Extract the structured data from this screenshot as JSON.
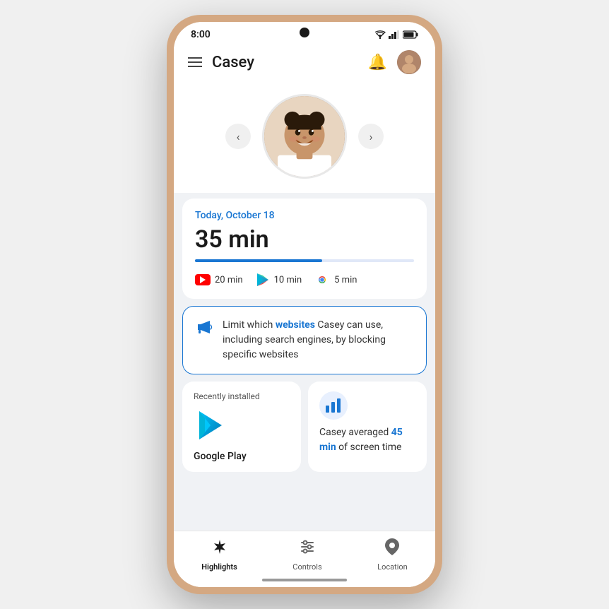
{
  "phone": {
    "status_bar": {
      "time": "8:00"
    },
    "top_nav": {
      "title": "Casey",
      "menu_icon": "hamburger",
      "bell_icon": "bell",
      "user_avatar": "parent-avatar"
    },
    "stats_card": {
      "date": "Today, October 18",
      "screen_time": "35 min",
      "progress_percent": 58,
      "apps": [
        {
          "name": "YouTube",
          "duration": "20 min",
          "icon": "youtube"
        },
        {
          "name": "Play Store",
          "duration": "10 min",
          "icon": "play-store"
        },
        {
          "name": "Chrome",
          "duration": "5 min",
          "icon": "chrome"
        }
      ]
    },
    "promo_card": {
      "icon": "megaphone",
      "text_plain": "Limit which ",
      "text_bold": "websites",
      "text_rest": " Casey can use, including search engines, by blocking specific websites"
    },
    "recently_card": {
      "label": "Recently installed",
      "app_name": "Google Play"
    },
    "avg_card": {
      "text_plain1": "Casey averaged ",
      "text_highlight": "45 min",
      "text_plain2": " of screen time"
    },
    "bottom_nav": {
      "items": [
        {
          "label": "Highlights",
          "icon": "sparkle",
          "active": true
        },
        {
          "label": "Controls",
          "icon": "sliders",
          "active": false
        },
        {
          "label": "Location",
          "icon": "location",
          "active": false
        }
      ]
    }
  }
}
